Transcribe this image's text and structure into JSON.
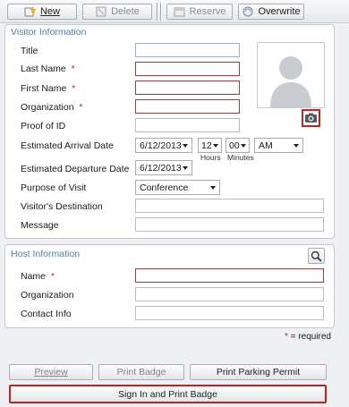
{
  "toolbar": {
    "new_label": "New",
    "delete_label": "Delete",
    "reserve_label": "Reserve",
    "overwrite_label": "Overwrite"
  },
  "visitor": {
    "section_title": "Visitor Information",
    "title_label": "Title",
    "last_name_label": "Last Name",
    "first_name_label": "First Name",
    "organization_label": "Organization",
    "proof_label": "Proof of ID",
    "arrival_label": "Estimated Arrival Date",
    "arrival_date": "6/12/2013",
    "arrival_hour": "12",
    "arrival_minute": "00",
    "arrival_ampm": "AM",
    "hours_caption": "Hours",
    "minutes_caption": "Minutes",
    "departure_label": "Estimated Departure Date",
    "departure_date": "6/12/2013",
    "purpose_label": "Purpose of Visit",
    "purpose_value": "Conference",
    "destination_label": "Visitor's Destination",
    "message_label": "Message",
    "required_marker": "*"
  },
  "host": {
    "section_title": "Host Information",
    "name_label": "Name",
    "organization_label": "Organization",
    "contact_label": "Contact Info"
  },
  "legend": {
    "marker": "*",
    "text": " = required"
  },
  "footer": {
    "preview_label": "Preview",
    "print_badge_label": "Print Badge",
    "print_parking_label": "Print Parking Permit",
    "sign_in_label": "Sign In and Print Badge"
  },
  "colors": {
    "accent": "#4a7fb5",
    "required": "#d21f1f",
    "highlight": "#cc1f1f"
  }
}
